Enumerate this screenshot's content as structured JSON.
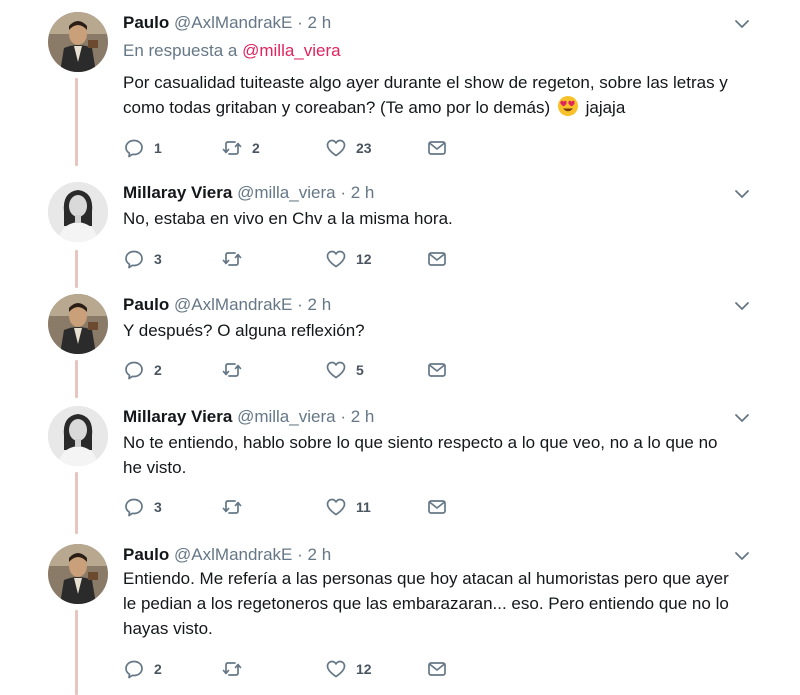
{
  "tweets": [
    {
      "name": "Paulo",
      "handle": "@AxlMandrakE",
      "dot": "·",
      "time": "2 h",
      "reply_prefix": "En respuesta a",
      "reply_mention": "@milla_viera",
      "text_lines": [
        "Por casualidad tuiteaste algo ayer durante el show de regeton, sobre las letras y",
        "como todas gritaban y coreaban? (Te amo por lo demás)",
        "jajaja"
      ],
      "replies": "1",
      "retweets": "2",
      "likes": "23"
    },
    {
      "name": "Millaray Viera",
      "handle": "@milla_viera",
      "dot": "·",
      "time": "2 h",
      "text_lines": [
        "No, estaba en vivo en Chv a la misma hora."
      ],
      "replies": "3",
      "retweets": "",
      "likes": "12"
    },
    {
      "name": "Paulo",
      "handle": "@AxlMandrakE",
      "dot": "·",
      "time": "2 h",
      "text_lines": [
        "Y después? O alguna reflexión?"
      ],
      "replies": "2",
      "retweets": "",
      "likes": "5"
    },
    {
      "name": "Millaray Viera",
      "handle": "@milla_viera",
      "dot": "·",
      "time": "2 h",
      "text_lines": [
        "No te entiendo, hablo sobre lo que siento respecto a lo que veo, no a lo que no",
        "he visto."
      ],
      "replies": "3",
      "retweets": "",
      "likes": "11"
    },
    {
      "name": "Paulo",
      "handle": "@AxlMandrakE",
      "dot": "·",
      "time": "2 h",
      "text_lines": [
        "Entiendo. Me refería a las personas que hoy atacan al humoristas pero que ayer",
        "le pedian a los regetoneros que las embarazaran... eso. Pero entiendo que no lo",
        "hayas visto."
      ],
      "replies": "2",
      "retweets": "",
      "likes": "12"
    }
  ],
  "icons": {
    "reply": "reply-icon",
    "retweet": "retweet-icon",
    "like": "heart-icon",
    "message": "envelope-icon",
    "caret": "chevron-down-icon",
    "emoji": "heart-eyes-emoji"
  },
  "colors": {
    "text": "#14171a",
    "secondary": "#657786",
    "mention": "#e0245e",
    "thread_line": "#e6c4c2"
  }
}
